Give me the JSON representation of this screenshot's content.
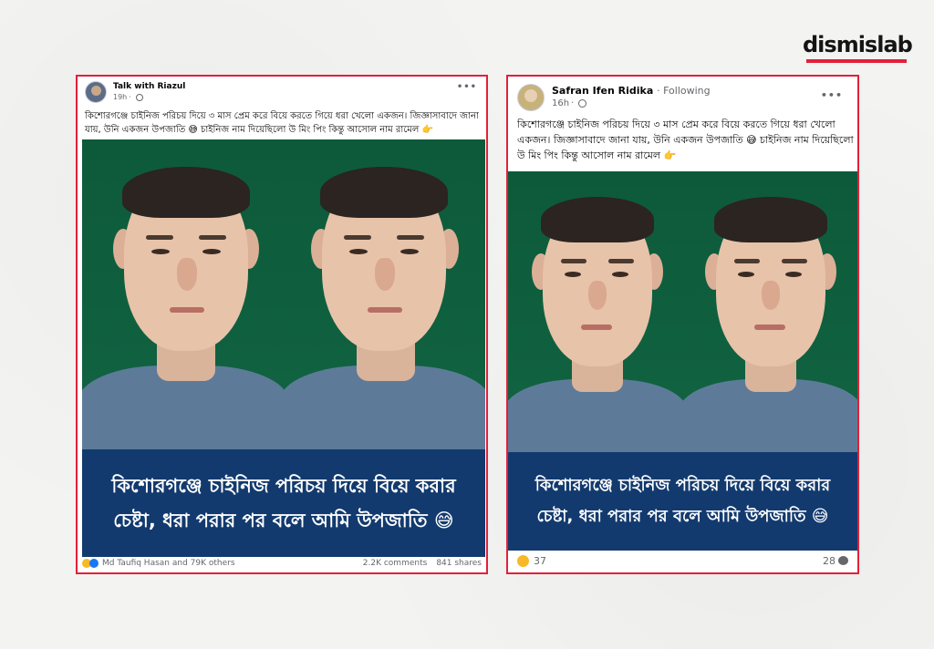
{
  "brand": {
    "logo_text": "dismislab",
    "accent": "#e2203a"
  },
  "post_left": {
    "author": "Talk with Riazul",
    "time": "19h",
    "caption": "কিশোরগঞ্জে চাইনিজ পরিচয় দিয়ে ৩ মাস প্রেম করে বিয়ে করতে গিয়ে ধরা খেলো একজন। জিজ্ঞাসাবাদে জানা যায়, উনি একজন উপজাতি 😅 চাইনিজ নাম দিয়েছিলো উ মিং পিং কিন্তু আসোল নাম রামেল 👉",
    "banner_line1": "কিশোরগঞ্জে চাইনিজ পরিচয় দিয়ে বিয়ে করার",
    "banner_line2": "চেষ্টা, ধরা পরার পর বলে আমি উপজাতি 😅",
    "reactions_text": "Md Taufiq Hasan and 79K others",
    "comments": "2.2K comments",
    "shares": "841 shares",
    "more_icon": "more-dots-icon"
  },
  "post_right": {
    "author": "Safran Ifen Ridika",
    "following": "· Following",
    "time": "16h",
    "caption": "কিশোরগঞ্জে চাইনিজ পরিচয় দিয়ে ৩ মাস প্রেম করে বিয়ে করতে গিয়ে ধরা খেলো একজন। জিজ্ঞাসাবাদে জানা যায়, উনি একজন উপজাতি 😅 চাইনিজ নাম দিয়েছিলো উ মিং পিং কিন্তু আসোল নাম রামেল 👉",
    "banner_line1": "কিশোরগঞ্জে চাইনিজ পরিচয় দিয়ে বিয়ে করার",
    "banner_line2": "চেষ্টা, ধরা পরার পর বলে আমি উপজাতি 😅",
    "reactions_count": "37",
    "comments_count": "28",
    "more_icon": "more-dots-icon"
  }
}
